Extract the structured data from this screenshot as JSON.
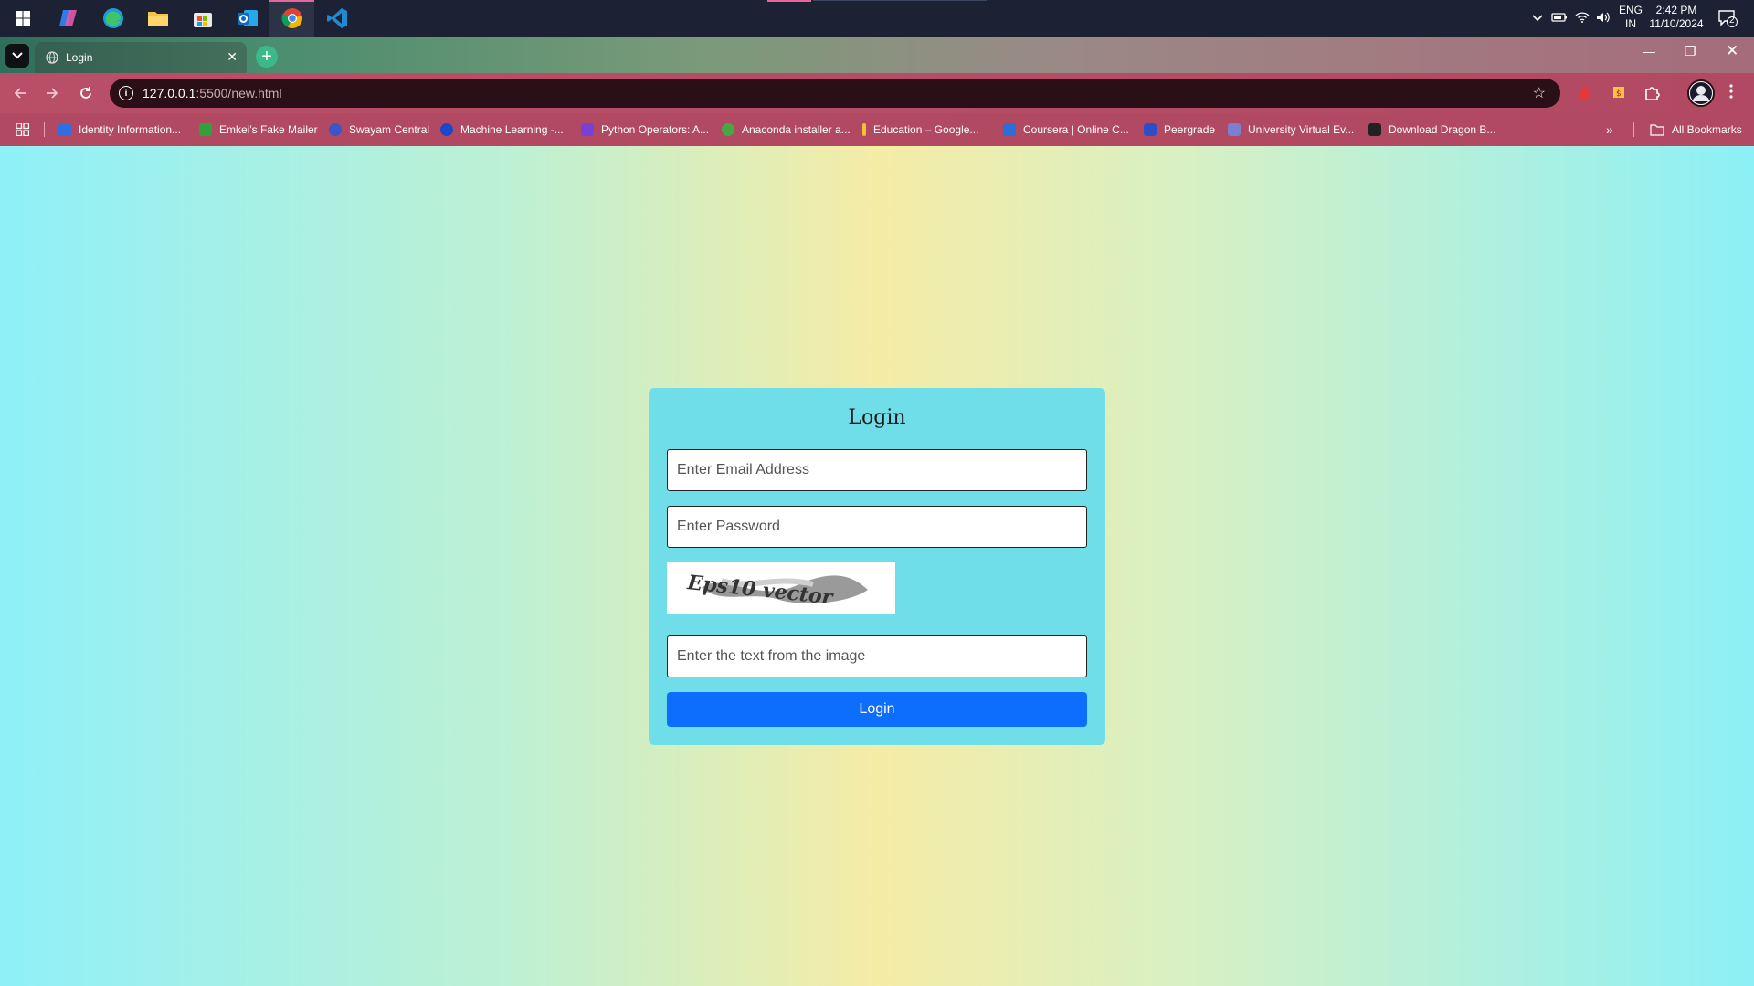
{
  "taskbar": {
    "apps": [
      "windows-start",
      "copilot",
      "edge",
      "file-explorer",
      "microsoft-store",
      "outlook",
      "chrome",
      "vscode"
    ],
    "tray": {
      "language_line1": "ENG",
      "language_line2": "IN",
      "time": "2:42 PM",
      "date": "11/10/2024",
      "notification_count": "2"
    }
  },
  "browser": {
    "tab_title": "Login",
    "url_host": "127.0.0.1",
    "url_path": ":5500/new.html",
    "bookmarks": [
      {
        "label": "Identity Information..."
      },
      {
        "label": "Emkei's Fake Mailer"
      },
      {
        "label": "Swayam Central"
      },
      {
        "label": "Machine Learning -..."
      },
      {
        "label": "Python Operators: A..."
      },
      {
        "label": "Anaconda installer a..."
      },
      {
        "label": "Education – Google..."
      },
      {
        "label": "Coursera | Online C..."
      },
      {
        "label": "Peergrade"
      },
      {
        "label": "University Virtual Ev..."
      },
      {
        "label": "Download Dragon B..."
      }
    ],
    "all_bookmarks_label": "All Bookmarks"
  },
  "login": {
    "title": "Login",
    "email_placeholder": "Enter Email Address",
    "password_placeholder": "Enter Password",
    "captcha_text": "Eps10 vector",
    "captcha_placeholder": "Enter the text from the image",
    "submit_label": "Login"
  },
  "colors": {
    "accent": "#0d6efd",
    "card": "#6fdee8"
  }
}
